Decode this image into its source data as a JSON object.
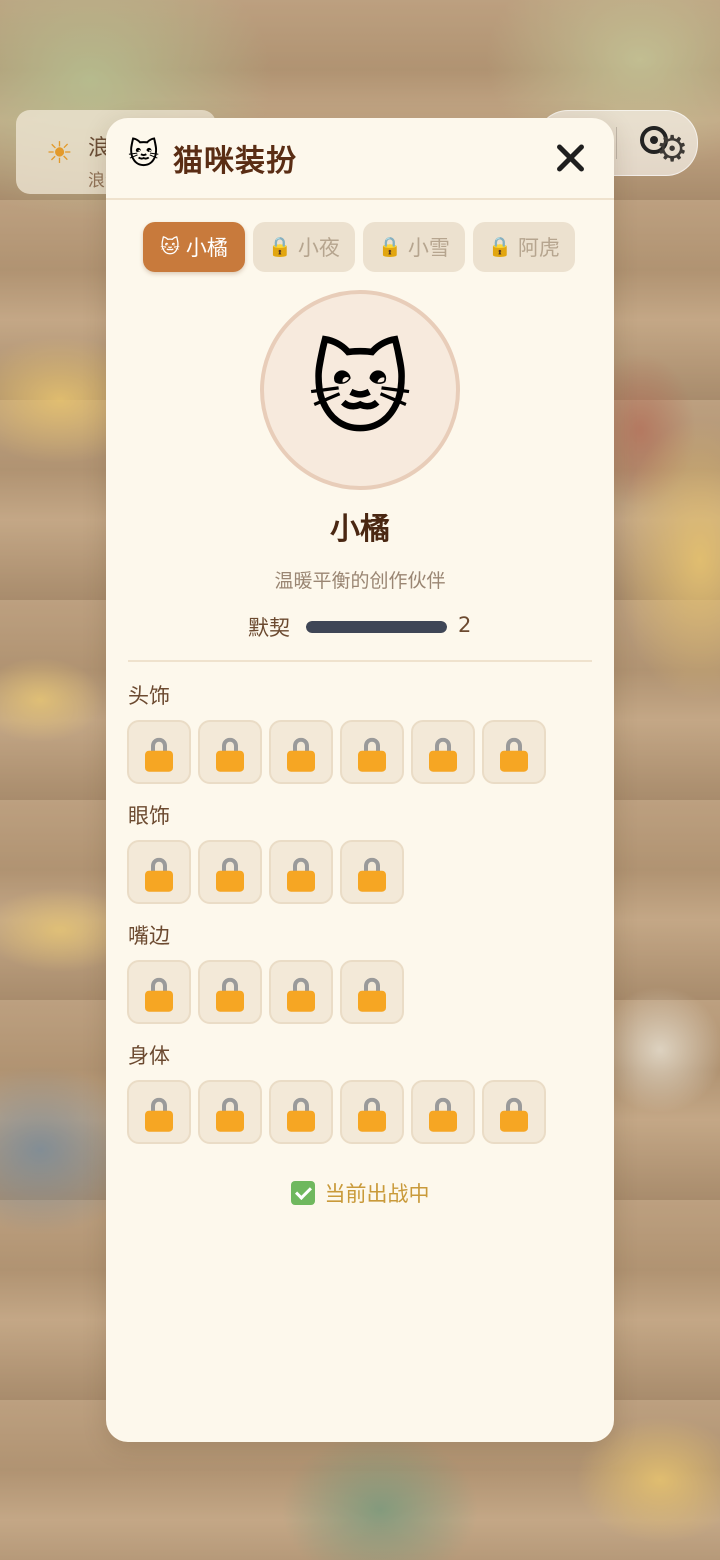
{
  "background": {
    "card_title": "浪漫",
    "card_subtitle": "浪漫",
    "card_icon": "sun-icon"
  },
  "capsule": {
    "more_icon": "more-icon",
    "close_icon": "target-icon"
  },
  "modal": {
    "title": "猫咪装扮",
    "title_icon": "cat-face-icon",
    "close_icon": "close-icon"
  },
  "tabs": [
    {
      "label": "小橘",
      "icon": "cat-face-icon",
      "active": true
    },
    {
      "label": "小夜",
      "icon": "lock-icon",
      "active": false
    },
    {
      "label": "小雪",
      "icon": "lock-icon",
      "active": false
    },
    {
      "label": "阿虎",
      "icon": "lock-icon",
      "active": false
    }
  ],
  "cat": {
    "name": "小橘",
    "description": "温暖平衡的创作伙伴",
    "bond_label": "默契",
    "bond_value": "2",
    "bond_fraction": 1.0
  },
  "sections": [
    {
      "title": "头饰",
      "slots": 6
    },
    {
      "title": "眼饰",
      "slots": 4
    },
    {
      "title": "嘴边",
      "slots": 4
    },
    {
      "title": "身体",
      "slots": 6
    }
  ],
  "status": {
    "text": "当前出战中",
    "checked": true
  },
  "colors": {
    "accent": "#c87a3c",
    "title_text": "#5a2d14",
    "modal_bg": "#fdf8ec",
    "lock_body": "#f6a623",
    "check": "#6fb85e"
  }
}
